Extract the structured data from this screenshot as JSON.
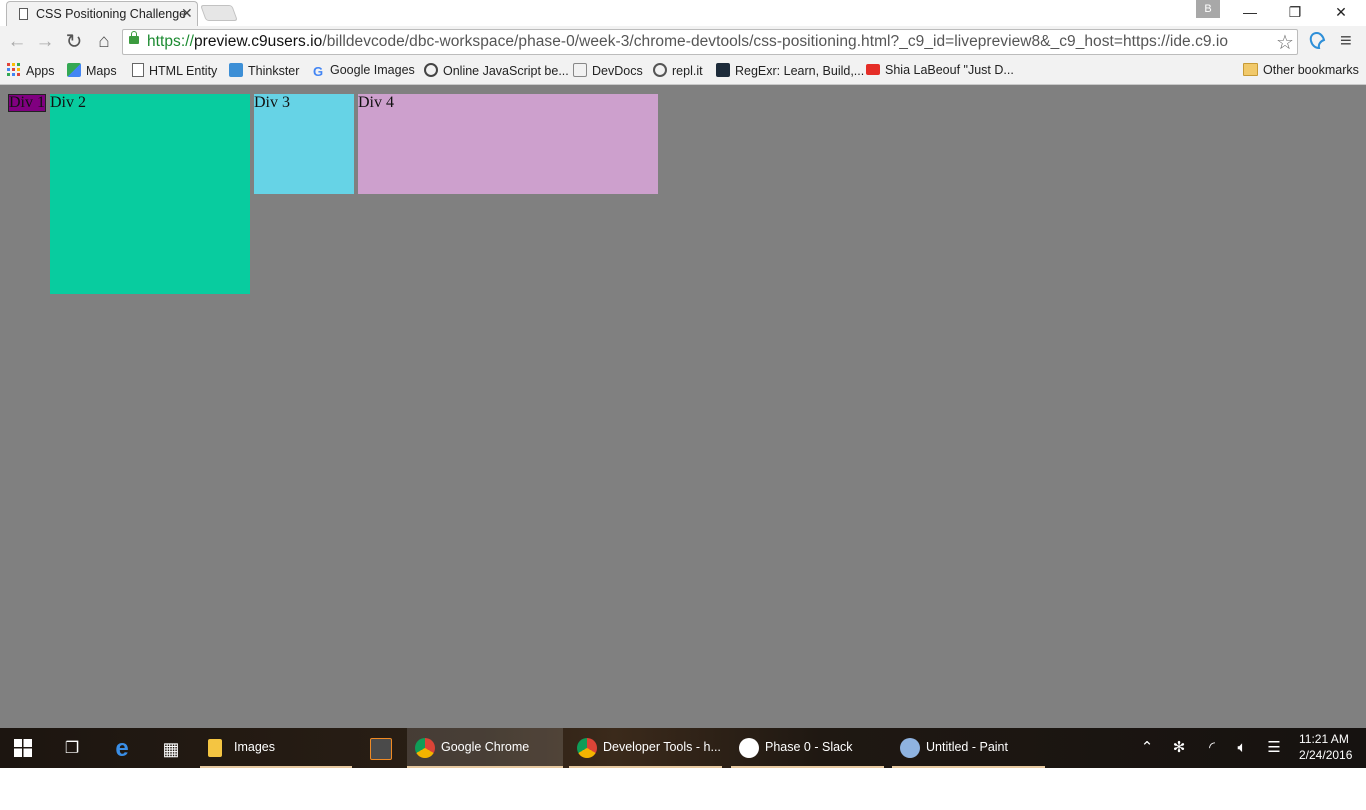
{
  "browser": {
    "tab_title": "CSS Positioning Challenge",
    "tab_close": "✕",
    "profile": "B",
    "window_controls": {
      "minimize": "—",
      "restore": "❐",
      "close": "✕"
    },
    "nav": {
      "back": "←",
      "forward": "→",
      "reload": "↻",
      "home": "⌂"
    },
    "url": {
      "scheme": "https://",
      "host": "preview.c9users.io",
      "path": "/billdevcode/dbc-workspace/phase-0/week-3/chrome-devtools/css-positioning.html?_c9_id=livepreview8&_c9_host=https://ide.c9.io"
    },
    "star": "☆",
    "menu": "≡"
  },
  "bookmarks": [
    {
      "label": "Apps",
      "icon": "apps-grid-icon",
      "color": "#e0443a"
    },
    {
      "label": "Maps",
      "icon": "maps-icon",
      "color": "#34a853"
    },
    {
      "label": "HTML Entity",
      "icon": "page-icon",
      "color": "#ffffff"
    },
    {
      "label": "Thinkster",
      "icon": "thinkster-icon",
      "color": "#3d8fd6"
    },
    {
      "label": "Google Images",
      "icon": "google-icon",
      "color": "#4285f4"
    },
    {
      "label": "Online JavaScript be...",
      "icon": "owl-icon",
      "color": "#444444"
    },
    {
      "label": "DevDocs",
      "icon": "devdocs-icon",
      "color": "#888888"
    },
    {
      "label": "repl.it",
      "icon": "replit-icon",
      "color": "#555555"
    },
    {
      "label": "RegExr: Learn, Build,...",
      "icon": "regexr-icon",
      "color": "#1d2b3a"
    },
    {
      "label": "Shia LaBeouf \"Just D...",
      "icon": "youtube-icon",
      "color": "#e52d27"
    }
  ],
  "other_bookmarks": "Other bookmarks",
  "page": {
    "div1": "Div 1",
    "div2": "Div 2",
    "div3": "Div 3",
    "div4": "Div 4"
  },
  "taskbar": {
    "items": [
      {
        "label": "Images",
        "icon": "folder-icon",
        "color": "#f4c542"
      },
      {
        "label": "",
        "icon": "sublime-icon",
        "color": "#f08a24"
      },
      {
        "label": "Google Chrome",
        "icon": "chrome-icon",
        "color": "#3c8ae8"
      },
      {
        "label": "Developer Tools - h...",
        "icon": "chrome-icon",
        "color": "#3c8ae8"
      },
      {
        "label": "Phase 0 - Slack",
        "icon": "slack-icon",
        "color": "#ffffff"
      },
      {
        "label": "Untitled - Paint",
        "icon": "paint-icon",
        "color": "#8fb3e0"
      }
    ],
    "time": "11:21 AM",
    "date": "2/24/2016"
  }
}
